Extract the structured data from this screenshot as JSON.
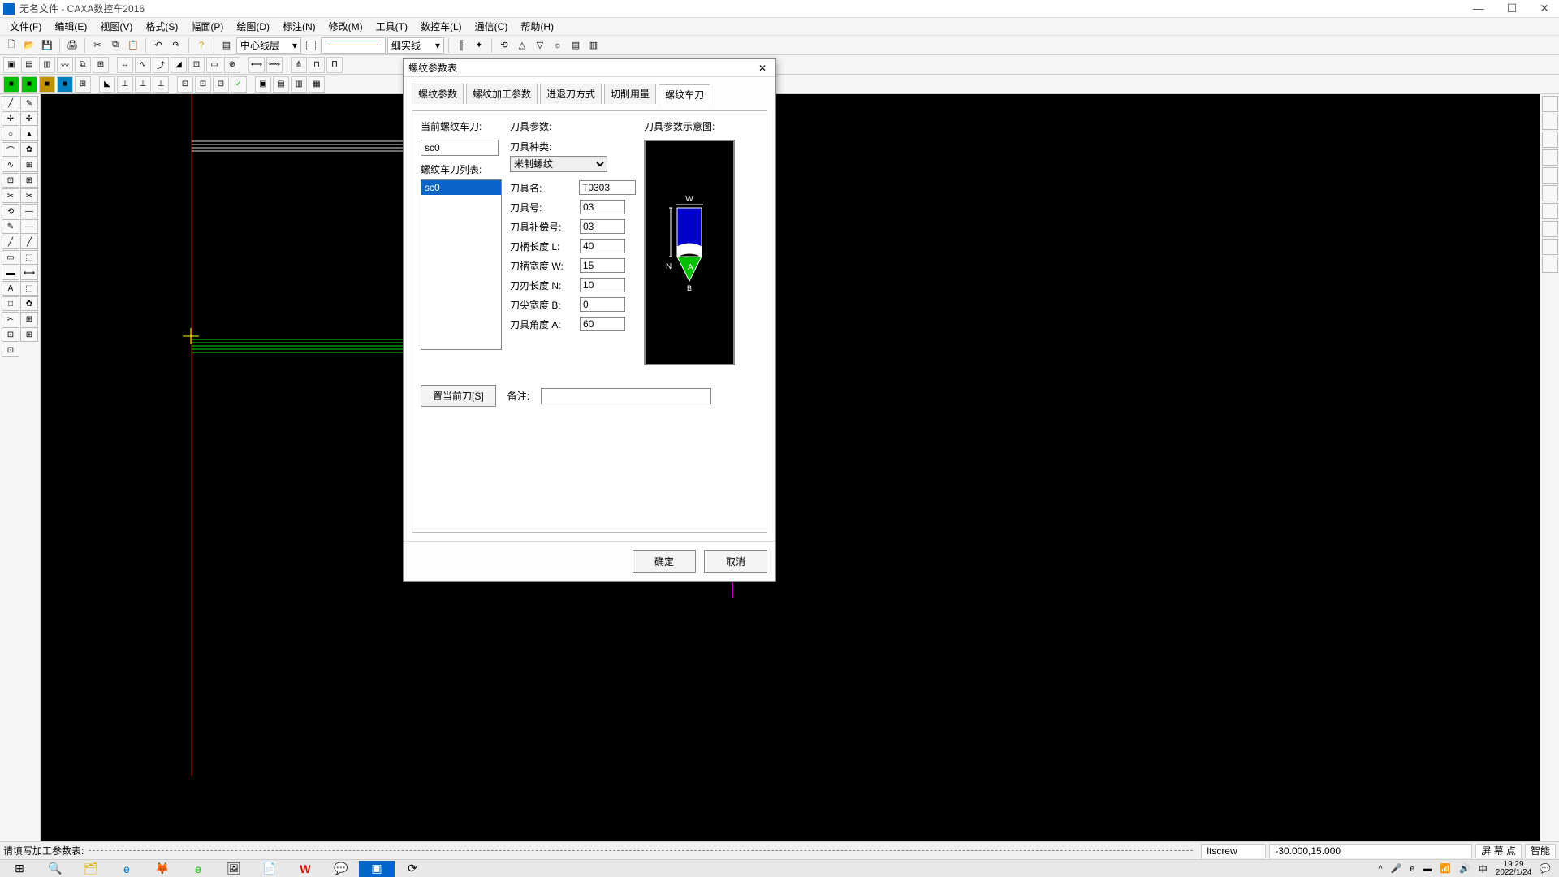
{
  "app": {
    "title": "无名文件 - CAXA数控车2016"
  },
  "menubar": [
    "文件(F)",
    "编辑(E)",
    "视图(V)",
    "格式(S)",
    "幅面(P)",
    "绘图(D)",
    "标注(N)",
    "修改(M)",
    "工具(T)",
    "数控车(L)",
    "通信(C)",
    "帮助(H)"
  ],
  "toolbar": {
    "layer_combo": "中心线层",
    "linetype_combo": "细实线"
  },
  "statusbar": {
    "prompt": "请填写加工参数表:",
    "cmd": "ltscrew",
    "coords": "-30.000,15.000",
    "screen": "屏 幕 点",
    "smart": "智能"
  },
  "taskbar": {
    "time": "19:29",
    "date": "2022/1/24",
    "ime": "中"
  },
  "dialog": {
    "title": "螺纹参数表",
    "tabs": [
      "螺纹参数",
      "螺纹加工参数",
      "进退刀方式",
      "切削用量",
      "螺纹车刀"
    ],
    "active_tab": 4,
    "labels": {
      "current_tool": "当前螺纹车刀:",
      "tool_params": "刀具参数:",
      "diagram": "刀具参数示意图:",
      "tool_list": "螺纹车刀列表:",
      "tool_type": "刀具种类:",
      "set_current": "置当前刀[S]",
      "remark": "备注:",
      "tool_name_lbl": "刀具名:",
      "tool_no_lbl": "刀具号:",
      "tool_comp_lbl": "刀具补偿号:",
      "handle_len_lbl": "刀柄长度 L:",
      "handle_wid_lbl": "刀柄宽度 W:",
      "edge_len_lbl": "刀刃长度 N:",
      "tip_wid_lbl": "刀尖宽度 B:",
      "tool_ang_lbl": "刀具角度 A:"
    },
    "current_tool": "sc0",
    "tool_list": [
      "sc0"
    ],
    "tool_type_selected": "米制螺纹",
    "params": {
      "tool_name": "T0303",
      "tool_no": "03",
      "tool_comp": "03",
      "handle_len": "40",
      "handle_wid": "15",
      "edge_len": "10",
      "tip_wid": "0",
      "tool_ang": "60"
    },
    "remark_value": "",
    "buttons": {
      "ok": "确定",
      "cancel": "取消"
    }
  }
}
